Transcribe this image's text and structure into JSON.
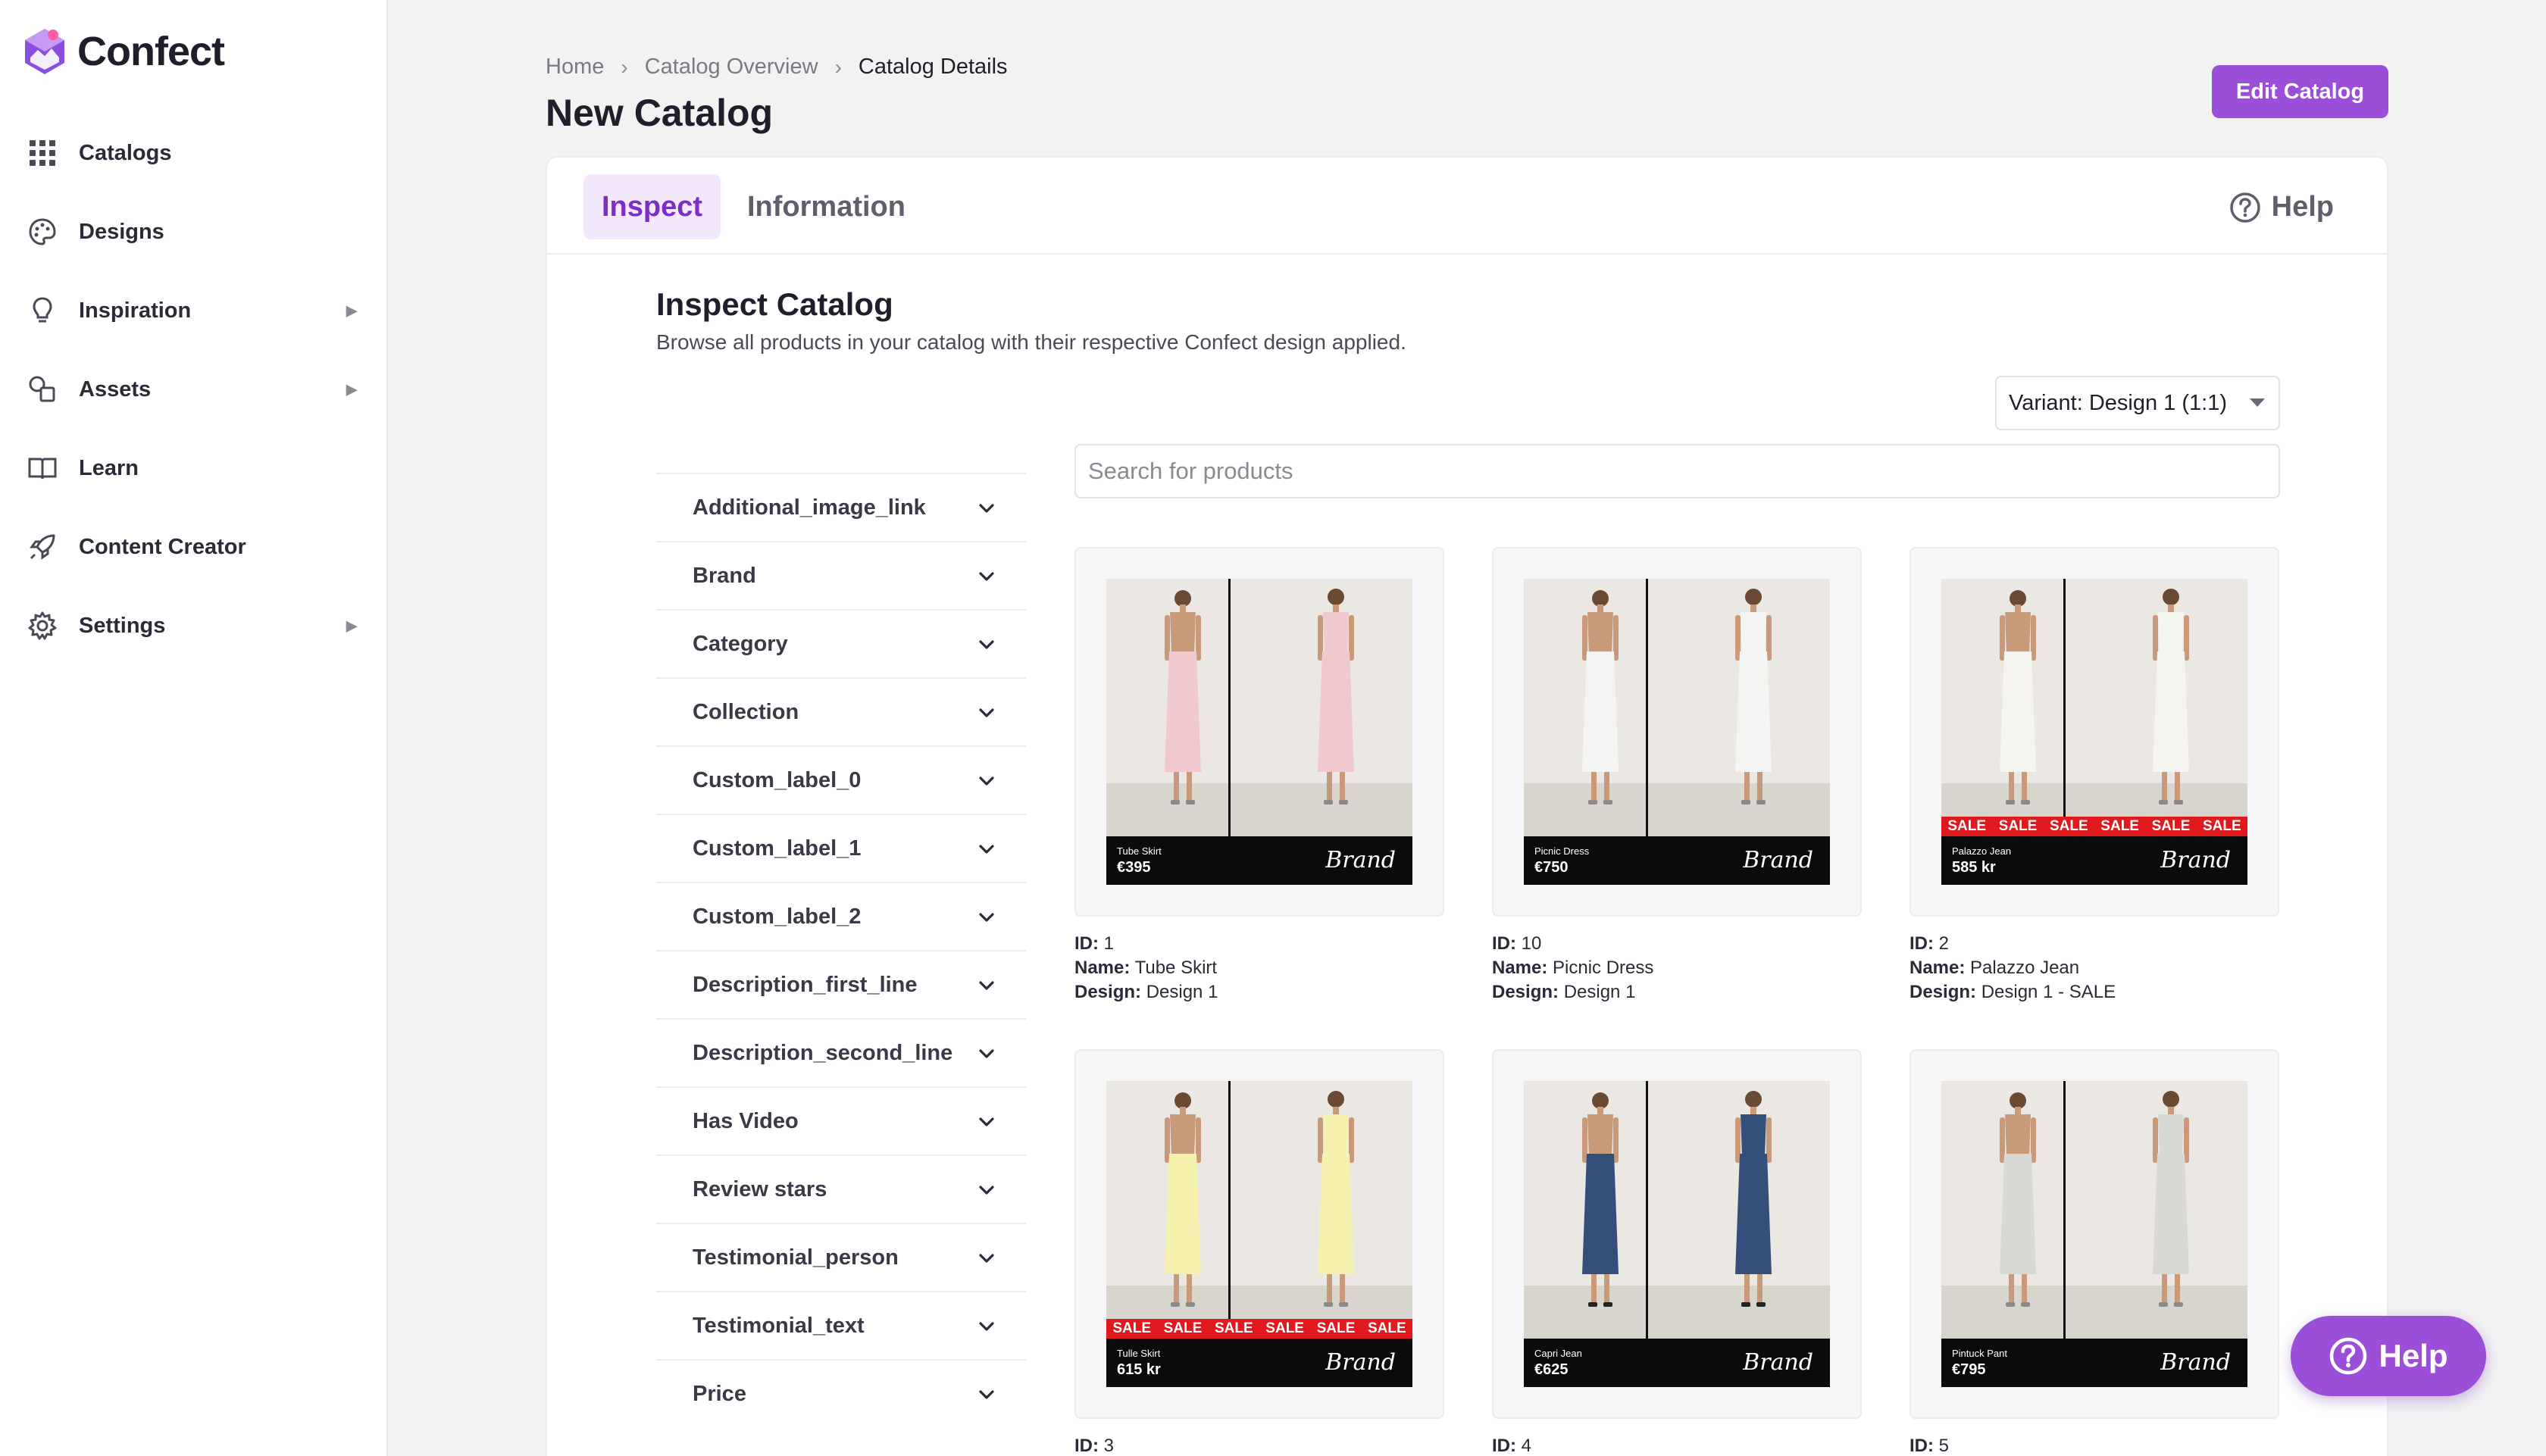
{
  "app": {
    "name": "Confect"
  },
  "sidebar": {
    "items": [
      {
        "label": "Catalogs",
        "icon": "grid-icon",
        "has_submenu": false
      },
      {
        "label": "Designs",
        "icon": "palette-icon",
        "has_submenu": false
      },
      {
        "label": "Inspiration",
        "icon": "lightbulb-icon",
        "has_submenu": true
      },
      {
        "label": "Assets",
        "icon": "shapes-icon",
        "has_submenu": true
      },
      {
        "label": "Learn",
        "icon": "book-icon",
        "has_submenu": false
      },
      {
        "label": "Content Creator",
        "icon": "rocket-icon",
        "has_submenu": false
      },
      {
        "label": "Settings",
        "icon": "gear-icon",
        "has_submenu": true
      }
    ]
  },
  "breadcrumb": {
    "home": "Home",
    "overview": "Catalog Overview",
    "current": "Catalog Details"
  },
  "page": {
    "title": "New Catalog",
    "edit_label": "Edit Catalog"
  },
  "tabs": {
    "inspect": "Inspect",
    "information": "Information",
    "help": "Help"
  },
  "inspect": {
    "title": "Inspect Catalog",
    "subtitle": "Browse all products in your catalog with their respective Confect design applied.",
    "variant": "Variant: Design 1 (1:1)",
    "search_placeholder": "Search for products"
  },
  "filters": [
    "Additional_image_link",
    "Brand",
    "Category",
    "Collection",
    "Custom_label_0",
    "Custom_label_1",
    "Custom_label_2",
    "Description_first_line",
    "Description_second_line",
    "Has Video",
    "Review stars",
    "Testimonial_person",
    "Testimonial_text",
    "Price"
  ],
  "meta_labels": {
    "id": "ID:",
    "name": "Name:",
    "design": "Design:"
  },
  "products": [
    {
      "id": "1",
      "name": "Tube Skirt",
      "design": "Design 1",
      "price": "€395",
      "sale": false,
      "color": "#f0c9cf"
    },
    {
      "id": "10",
      "name": "Picnic Dress",
      "design": "Design 1",
      "price": "€750",
      "sale": false,
      "color": "#f4f4f2"
    },
    {
      "id": "2",
      "name": "Palazzo Jean",
      "design": "Design 1 - SALE",
      "price": "585 kr",
      "sale": true,
      "color": "#f6f4ee"
    },
    {
      "id": "3",
      "name": "Tulle Skirt",
      "design": "",
      "price": "615 kr",
      "sale": true,
      "color": "#f5f2b0"
    },
    {
      "id": "4",
      "name": "Capri Jean",
      "design": "",
      "price": "€625",
      "sale": false,
      "color": "#34507a"
    },
    {
      "id": "5",
      "name": "Pintuck Pant",
      "design": "",
      "price": "€795",
      "sale": false,
      "color": "#d9d9d4"
    }
  ],
  "sale_word": "SALE",
  "brand_script": "Brand",
  "help_fab": "Help",
  "colors": {
    "accent": "#9b4fd9",
    "accent_light": "#f3e8fc",
    "sale_red": "#e0191f"
  }
}
